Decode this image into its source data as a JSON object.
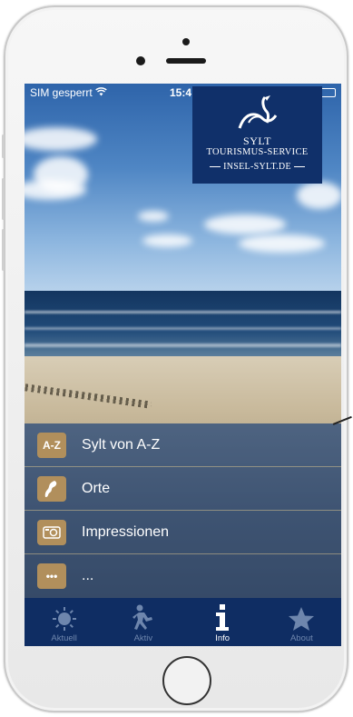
{
  "status_bar": {
    "carrier": "SIM gesperrt",
    "time": "15:4"
  },
  "logo": {
    "line1": "SYLT",
    "line2": "TOURISMUS-SERVICE",
    "line3": "INSEL-SYLT.DE"
  },
  "menu": {
    "items": [
      {
        "icon": "a-z-icon",
        "icon_text": "A-Z",
        "label": "Sylt von A-Z"
      },
      {
        "icon": "island-map-icon",
        "label": "Orte"
      },
      {
        "icon": "camera-icon",
        "label": "Impressionen"
      },
      {
        "icon": "more-dots-icon",
        "icon_text": "•••",
        "label": "..."
      }
    ]
  },
  "tabs": [
    {
      "label": "Aktuell",
      "icon": "sun-icon",
      "active": false
    },
    {
      "label": "Aktiv",
      "icon": "runner-icon",
      "active": false
    },
    {
      "label": "Info",
      "icon": "info-icon",
      "active": true
    },
    {
      "label": "About",
      "icon": "star-icon",
      "active": false
    }
  ],
  "colors": {
    "tab_bar": "#0f2d63",
    "menu_icon_bg": "#b18f5c",
    "logo_bg": "#10306a",
    "tab_inactive": "#6e86ad"
  }
}
